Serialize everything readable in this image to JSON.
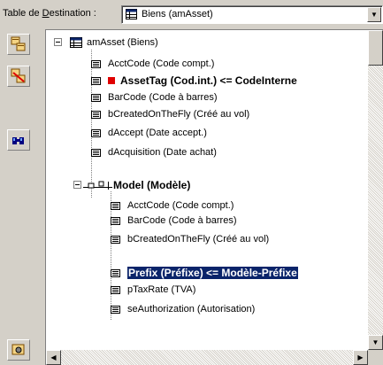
{
  "header": {
    "label_prefix": "Table de ",
    "label_mnemonic": "D",
    "label_suffix": "estination :",
    "combo_value": "Biens (amAsset)"
  },
  "tree": {
    "root": "amAsset (Biens)",
    "items": [
      "AcctCode (Code compt.)",
      "AssetTag (Cod.int.)  <=  CodeInterne",
      "BarCode (Code à barres)",
      "bCreatedOnTheFly (Créé au vol)",
      "dAccept (Date accept.)",
      "dAcquisition (Date achat)"
    ],
    "model_node": "Model (Modèle)",
    "model_items": [
      "AcctCode (Code compt.)",
      "BarCode (Code à barres)",
      "bCreatedOnTheFly (Créé au vol)",
      "Prefix (Préfixe)  <=  Modèle-Préfixe",
      "pTaxRate (TVA)",
      "seAuthorization (Autorisation)"
    ]
  },
  "toolbar": {
    "buttons": [
      "add-link-icon",
      "remove-link-icon",
      "find-icon",
      "settings-icon"
    ]
  },
  "colors": {
    "selection": "#0a246a",
    "mapped_marker": "#e00000",
    "face": "#d4d0c8"
  }
}
